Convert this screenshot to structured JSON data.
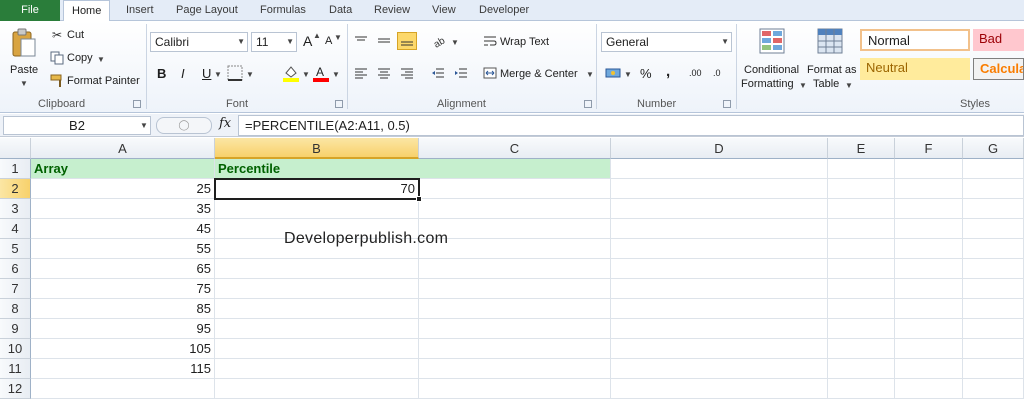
{
  "ribbon_tabs": {
    "file": "File",
    "items": [
      "Home",
      "Insert",
      "Page Layout",
      "Formulas",
      "Data",
      "Review",
      "View",
      "Developer"
    ],
    "active": "Home"
  },
  "clipboard": {
    "paste": "Paste",
    "cut": "Cut",
    "copy": "Copy",
    "format_painter": "Format Painter",
    "label": "Clipboard"
  },
  "font": {
    "name": "Calibri",
    "size": "11",
    "bold": "B",
    "italic": "I",
    "underline": "U",
    "grow": "A",
    "shrink": "A",
    "fill_color": "#ffff00",
    "font_color": "#ff0000",
    "label": "Font"
  },
  "alignment": {
    "wrap_text": "Wrap Text",
    "merge_center": "Merge & Center",
    "label": "Alignment"
  },
  "number": {
    "format": "General",
    "percent": "%",
    "comma": ",",
    "inc_decimal": ".00",
    "dec_decimal": ".0",
    "label": "Number"
  },
  "styles": {
    "conditional_formatting_1": "Conditional",
    "conditional_formatting_2": "Formatting",
    "format_table_1": "Format as",
    "format_table_2": "Table",
    "normal": "Normal",
    "bad": "Bad",
    "neutral": "Neutral",
    "calculation": "Calculat",
    "label": "Styles"
  },
  "formula_bar": {
    "name_box": "B2",
    "fx": "fx",
    "formula": "=PERCENTILE(A2:A11, 0.5)"
  },
  "sheet": {
    "columns": [
      "A",
      "B",
      "C",
      "D",
      "E",
      "F",
      "G"
    ],
    "rows": [
      "1",
      "2",
      "3",
      "4",
      "5",
      "6",
      "7",
      "8",
      "9",
      "10",
      "11",
      "12"
    ],
    "header_a": "Array",
    "header_b": "Percentile",
    "array_values": [
      "25",
      "35",
      "45",
      "55",
      "65",
      "75",
      "85",
      "95",
      "105",
      "115"
    ],
    "result": "70",
    "watermark": "Developerpublish.com",
    "header_fill": "#c6efce",
    "header_text": "#006100"
  }
}
